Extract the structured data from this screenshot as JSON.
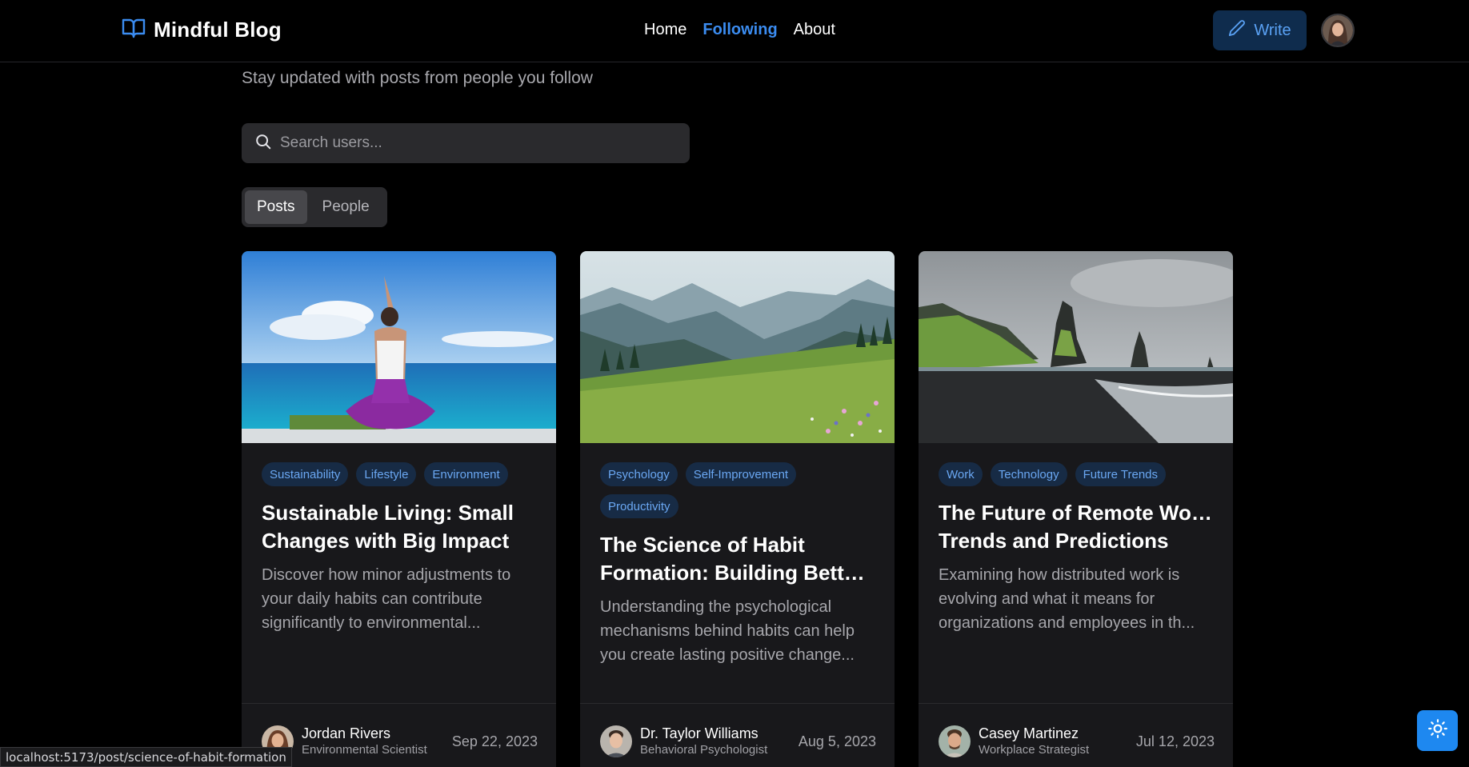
{
  "header": {
    "brand": "Mindful Blog",
    "nav": [
      "Home",
      "Following",
      "About"
    ],
    "active_nav": "Following",
    "write_label": "Write"
  },
  "page": {
    "subtitle": "Stay updated with posts from people you follow"
  },
  "search": {
    "placeholder": "Search users..."
  },
  "tabs": {
    "items": [
      "Posts",
      "People"
    ],
    "active": "Posts"
  },
  "posts": [
    {
      "tags": [
        "Sustainability",
        "Lifestyle",
        "Environment"
      ],
      "title_line1": "Sustainable Living: Small",
      "title_line2": "Changes with Big Impact",
      "excerpt_line1": "Discover how minor adjustments to",
      "excerpt_line2": "your daily habits can contribute",
      "excerpt_line3": "significantly to environmental...",
      "author_name": "Jordan Rivers",
      "author_role": "Environmental Scientist",
      "date": "Sep 22, 2023"
    },
    {
      "tags": [
        "Psychology",
        "Self-Improvement",
        "Productivity"
      ],
      "title_line1": "The Science of Habit",
      "title_line2": "Formation: Building Better...",
      "excerpt_line1": "Understanding the psychological",
      "excerpt_line2": "mechanisms behind habits can help",
      "excerpt_line3": "you create lasting positive change...",
      "author_name": "Dr. Taylor Williams",
      "author_role": "Behavioral Psychologist",
      "date": "Aug 5, 2023"
    },
    {
      "tags": [
        "Work",
        "Technology",
        "Future Trends"
      ],
      "title_line1": "The Future of Remote Work:",
      "title_line2": "Trends and Predictions",
      "excerpt_line1": "Examining how distributed work is",
      "excerpt_line2": "evolving and what it means for",
      "excerpt_line3": "organizations and employees in th...",
      "author_name": "Casey Martinez",
      "author_role": "Workplace Strategist",
      "date": "Jul 12, 2023"
    }
  ],
  "status_bar": {
    "url": "localhost:5173/post/science-of-habit-formation"
  },
  "colors": {
    "accent": "#3b8cf0",
    "tag_bg": "#172b45",
    "tag_text": "#6aa7f2",
    "card_bg": "#18181b",
    "theme_button": "#1e88f0"
  },
  "icons": {
    "brand": "book-open-icon",
    "write": "pencil-icon",
    "search": "search-icon",
    "theme": "sun-icon"
  }
}
